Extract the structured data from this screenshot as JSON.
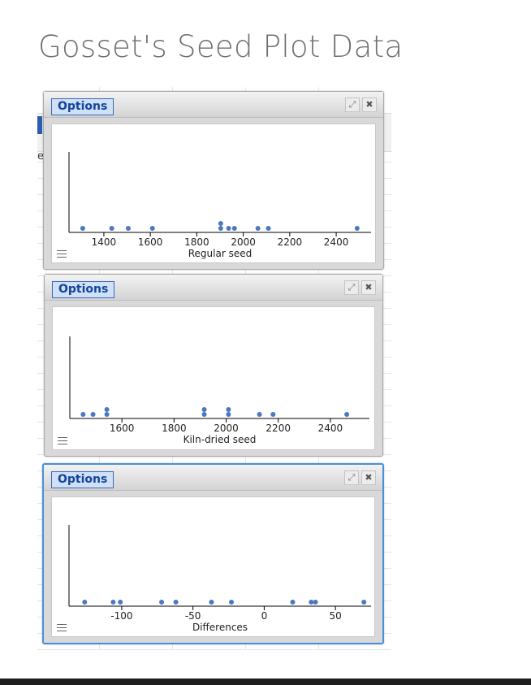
{
  "page": {
    "title": "Gosset's Seed Plot Data"
  },
  "background": {
    "edge_text": "e"
  },
  "panels": [
    {
      "options_label": "Options",
      "expand_icon": "expand-icon",
      "close_icon": "close-icon",
      "menu_icon": "menu-icon",
      "chart_data": {
        "type": "scatter",
        "xlabel": "Regular seed",
        "xlim": [
          1250,
          2550
        ],
        "ticks": [
          1400,
          1600,
          1800,
          2000,
          2200,
          2400
        ],
        "points": [
          1309,
          1434,
          1505,
          1609,
          1903,
          1903,
          1937,
          1962,
          2063,
          2108,
          2490
        ],
        "color": "#4a78c2"
      }
    },
    {
      "options_label": "Options",
      "expand_icon": "expand-icon",
      "close_icon": "close-icon",
      "menu_icon": "menu-icon",
      "chart_data": {
        "type": "scatter",
        "xlabel": "Kiln-dried seed",
        "xlim": [
          1400,
          2550
        ],
        "ticks": [
          1600,
          1800,
          2000,
          2200,
          2400
        ],
        "points": [
          1451,
          1489,
          1542,
          1542,
          1916,
          1916,
          2009,
          2009,
          2128,
          2180,
          2463
        ],
        "color": "#4a78c2"
      }
    },
    {
      "options_label": "Options",
      "expand_icon": "expand-icon",
      "close_icon": "close-icon",
      "menu_icon": "menu-icon",
      "chart_data": {
        "type": "scatter",
        "xlabel": "Differences",
        "xlim": [
          -137,
          75
        ],
        "ticks": [
          -100,
          -50,
          0,
          50
        ],
        "ticklabels": [
          "-100",
          "-50",
          "0",
          "50"
        ],
        "points": [
          -126,
          -106,
          -101,
          -72,
          -62,
          -37,
          -23,
          20,
          33,
          36,
          70
        ],
        "color": "#4a78c2"
      }
    }
  ]
}
